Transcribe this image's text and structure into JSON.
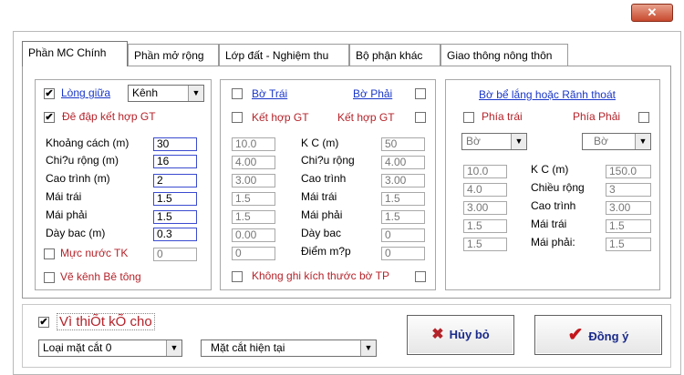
{
  "window": {
    "close_symbol": "✕"
  },
  "tabs": [
    {
      "label": "Phần MC Chính"
    },
    {
      "label": "Phần mở rộng"
    },
    {
      "label": "Lớp đất - Nghiệm thu"
    },
    {
      "label": "Bộ phận khác"
    },
    {
      "label": "Giao thông nông thôn"
    }
  ],
  "left_group": {
    "long_giua_label": "Lòng giữa",
    "kenh_select": "Kênh",
    "de_dap_label": "Đê đập kết hợp GT",
    "fields": [
      {
        "label": "Khoảng cách  (m)",
        "value": "30"
      },
      {
        "label": "Chi?u rộng  (m)",
        "value": "16"
      },
      {
        "label": "Cao trình  (m)",
        "value": "2"
      },
      {
        "label": "Mái trái",
        "value": "1.5"
      },
      {
        "label": "Mái phải",
        "value": "1.5"
      },
      {
        "label": "Dày bac (m)",
        "value": "0.3"
      }
    ],
    "muc_nuoc_label": "Mực nước TK",
    "muc_nuoc_value": "0",
    "ve_kenh_label": "Vẽ kênh Bê tông"
  },
  "middle_group": {
    "bo_trai_label": "Bờ Trái",
    "bo_phai_label": "Bờ  Phải",
    "ket_hop_left": "Kết hợp GT",
    "ket_hop_right": "Kết hợp GT",
    "left_values": [
      "10.0",
      "4.00",
      "3.00",
      "1.5",
      "1.5",
      "0.00",
      "0"
    ],
    "labels": [
      "K C (m)",
      "Chi?u rộng",
      "Cao trình",
      "Mái trái",
      "Mái phải",
      "Dày bac",
      "Điểm m?p"
    ],
    "right_values": [
      "50",
      "4.00",
      "3.00",
      "1.5",
      "1.5",
      "0",
      "0"
    ],
    "khong_ghi_label": "Không ghi kích thước bờ TP"
  },
  "right_group": {
    "title": "Bờ bể lắng hoặc Rãnh thoát",
    "phia_trai_label": "Phía trái",
    "phia_phai_label": "Phía Phải",
    "left_select": "Bờ",
    "right_select": "Bờ",
    "left_values": [
      "10.0",
      "4.0",
      "3.00",
      "1.5",
      "1.5"
    ],
    "labels": [
      "K C (m)",
      "Chiều rộng",
      "Cao trình",
      "Mái  trái",
      "Mái phải:"
    ],
    "right_values": [
      "150.0",
      "3",
      "3.00",
      "1.5",
      "1.5"
    ]
  },
  "bottom": {
    "vi_thiet_label": "Vì thiÕt kÕ cho",
    "loai_mat_cat_select": "Loại mặt cắt  0",
    "mat_cat_select": "Mặt cắt hiện tại",
    "cancel_label": "Hủy bỏ",
    "ok_label": "Đồng ý"
  }
}
